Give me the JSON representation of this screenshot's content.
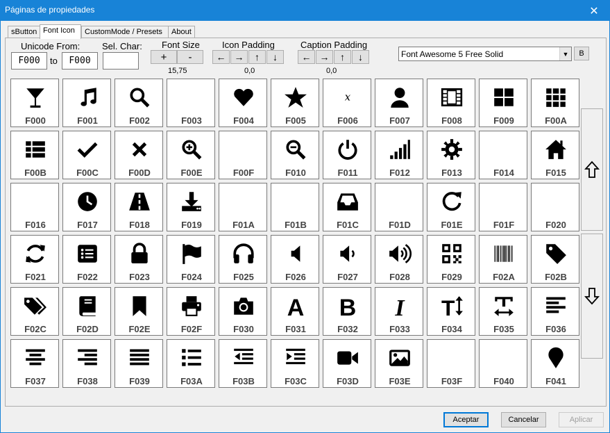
{
  "window": {
    "title": "Páginas de propiedades",
    "close_glyph": "✕"
  },
  "tabs": [
    {
      "label": "sButton",
      "active": false
    },
    {
      "label": "Font Icon",
      "active": true
    },
    {
      "label": "CustomMode / Presets",
      "active": false
    },
    {
      "label": "About",
      "active": false
    }
  ],
  "controls": {
    "unicode_from_label": "Unicode From:",
    "unicode_from": "F000",
    "to_label": "to",
    "unicode_to": "F000",
    "sel_char_label": "Sel. Char:",
    "sel_char_value": "",
    "font_size_label": "Font Size",
    "font_size_plus": "+",
    "font_size_minus": "-",
    "font_size_value": "15,75",
    "icon_padding_label": "Icon Padding",
    "icon_padding_value": "0,0",
    "caption_padding_label": "Caption Padding",
    "caption_padding_value": "0,0",
    "arrow_left": "←",
    "arrow_right": "→",
    "arrow_up": "↑",
    "arrow_down": "↓",
    "font_family": "Font Awesome 5 Free Solid",
    "b_button": "B"
  },
  "icons": [
    {
      "code": "F000",
      "icon": "glass-martini"
    },
    {
      "code": "F001",
      "icon": "music"
    },
    {
      "code": "F002",
      "icon": "search"
    },
    {
      "code": "F003",
      "icon": ""
    },
    {
      "code": "F004",
      "icon": "heart"
    },
    {
      "code": "F005",
      "icon": "star"
    },
    {
      "code": "F006",
      "icon": "star-outline"
    },
    {
      "code": "F007",
      "icon": "user"
    },
    {
      "code": "F008",
      "icon": "film"
    },
    {
      "code": "F009",
      "icon": "th-large"
    },
    {
      "code": "F00A",
      "icon": "th"
    },
    {
      "code": "F00B",
      "icon": "th-list"
    },
    {
      "code": "F00C",
      "icon": "check"
    },
    {
      "code": "F00D",
      "icon": "times"
    },
    {
      "code": "F00E",
      "icon": "search-plus"
    },
    {
      "code": "F00F",
      "icon": ""
    },
    {
      "code": "F010",
      "icon": "search-minus"
    },
    {
      "code": "F011",
      "icon": "power-off"
    },
    {
      "code": "F012",
      "icon": "signal"
    },
    {
      "code": "F013",
      "icon": "cog"
    },
    {
      "code": "F014",
      "icon": ""
    },
    {
      "code": "F015",
      "icon": "home"
    },
    {
      "code": "F016",
      "icon": ""
    },
    {
      "code": "F017",
      "icon": "clock"
    },
    {
      "code": "F018",
      "icon": "road"
    },
    {
      "code": "F019",
      "icon": "download"
    },
    {
      "code": "F01A",
      "icon": ""
    },
    {
      "code": "F01B",
      "icon": ""
    },
    {
      "code": "F01C",
      "icon": "inbox"
    },
    {
      "code": "F01D",
      "icon": ""
    },
    {
      "code": "F01E",
      "icon": "redo"
    },
    {
      "code": "F01F",
      "icon": ""
    },
    {
      "code": "F020",
      "icon": ""
    },
    {
      "code": "F021",
      "icon": "sync"
    },
    {
      "code": "F022",
      "icon": "list-alt"
    },
    {
      "code": "F023",
      "icon": "lock"
    },
    {
      "code": "F024",
      "icon": "flag"
    },
    {
      "code": "F025",
      "icon": "headphones"
    },
    {
      "code": "F026",
      "icon": "volume-off"
    },
    {
      "code": "F027",
      "icon": "volume-down"
    },
    {
      "code": "F028",
      "icon": "volume-up"
    },
    {
      "code": "F029",
      "icon": "qrcode"
    },
    {
      "code": "F02A",
      "icon": "barcode"
    },
    {
      "code": "F02B",
      "icon": "tag"
    },
    {
      "code": "F02C",
      "icon": "tags"
    },
    {
      "code": "F02D",
      "icon": "book"
    },
    {
      "code": "F02E",
      "icon": "bookmark"
    },
    {
      "code": "F02F",
      "icon": "print"
    },
    {
      "code": "F030",
      "icon": "camera"
    },
    {
      "code": "F031",
      "icon": "font"
    },
    {
      "code": "F032",
      "icon": "bold"
    },
    {
      "code": "F033",
      "icon": "italic"
    },
    {
      "code": "F034",
      "icon": "text-height"
    },
    {
      "code": "F035",
      "icon": "text-width"
    },
    {
      "code": "F036",
      "icon": "align-left"
    },
    {
      "code": "F037",
      "icon": "align-center"
    },
    {
      "code": "F038",
      "icon": "align-right"
    },
    {
      "code": "F039",
      "icon": "align-justify"
    },
    {
      "code": "F03A",
      "icon": "list"
    },
    {
      "code": "F03B",
      "icon": "outdent"
    },
    {
      "code": "F03C",
      "icon": "indent"
    },
    {
      "code": "F03D",
      "icon": "video"
    },
    {
      "code": "F03E",
      "icon": "image"
    },
    {
      "code": "F03F",
      "icon": ""
    },
    {
      "code": "F040",
      "icon": ""
    },
    {
      "code": "F041",
      "icon": "map-marker"
    }
  ],
  "scroll": {
    "up": "scroll-up-arrow",
    "down": "scroll-down-arrow"
  },
  "buttons": {
    "accept": "Aceptar",
    "cancel": "Cancelar",
    "apply": "Aplicar"
  },
  "colors": {
    "titlebar": "#1883d7",
    "icon": "#000000",
    "caption": "#444444"
  }
}
